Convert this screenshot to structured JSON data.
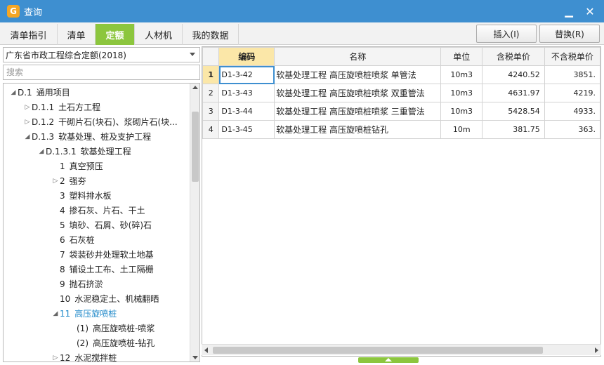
{
  "window": {
    "title": "查询",
    "app_icon": "app-logo-icon",
    "accent": "#3e8fd0"
  },
  "tabs": [
    {
      "label": "清单指引",
      "active": false
    },
    {
      "label": "清单",
      "active": false
    },
    {
      "label": "定额",
      "active": true
    },
    {
      "label": "人材机",
      "active": false
    },
    {
      "label": "我的数据",
      "active": false
    }
  ],
  "actions": {
    "insert_label": "插入(I)",
    "replace_label": "替换(R)"
  },
  "left": {
    "library_selected": "广东省市政工程综合定额(2018)",
    "search_placeholder": "搜索",
    "tree": [
      {
        "arrow": "◢",
        "code": "D.1",
        "label": "通用项目"
      },
      {
        "arrow": "▷",
        "code": "D.1.1",
        "label": "土石方工程"
      },
      {
        "arrow": "▷",
        "code": "D.1.2",
        "label": "干砌片石(块石)、浆砌片石(块..."
      },
      {
        "arrow": "◢",
        "code": "D.1.3",
        "label": "软基处理、桩及支护工程"
      },
      {
        "arrow": "◢",
        "code": "D.1.3.1",
        "label": "软基处理工程"
      },
      {
        "arrow": "",
        "code": "1",
        "label": "真空预压"
      },
      {
        "arrow": "▷",
        "code": "2",
        "label": "强夯"
      },
      {
        "arrow": "",
        "code": "3",
        "label": "塑料排水板"
      },
      {
        "arrow": "",
        "code": "4",
        "label": "掺石灰、片石、干土"
      },
      {
        "arrow": "",
        "code": "5",
        "label": "填砂、石屑、砂(碎)石"
      },
      {
        "arrow": "",
        "code": "6",
        "label": "石灰桩"
      },
      {
        "arrow": "",
        "code": "7",
        "label": "袋装砂井处理软土地基"
      },
      {
        "arrow": "",
        "code": "8",
        "label": "铺设土工布、土工隔栅"
      },
      {
        "arrow": "",
        "code": "9",
        "label": "抛石挤淤"
      },
      {
        "arrow": "",
        "code": "10",
        "label": "水泥稳定土、机械翻晒"
      },
      {
        "arrow": "◢",
        "code": "11",
        "label": "高压旋喷桩"
      },
      {
        "arrow": "",
        "code": "(1)",
        "label": "高压旋喷桩-喷浆"
      },
      {
        "arrow": "",
        "code": "(2)",
        "label": "高压旋喷桩-钻孔"
      },
      {
        "arrow": "▷",
        "code": "12",
        "label": "水泥搅拌桩"
      }
    ]
  },
  "grid": {
    "columns": [
      "",
      "编码",
      "名称",
      "单位",
      "含税单价",
      "不含税单价"
    ],
    "rows": [
      {
        "no": "1",
        "code": "D1-3-42",
        "name": "软基处理工程 高压旋喷桩喷浆 单管法",
        "unit": "10m3",
        "price_tax": "4240.52",
        "price_notax": "3851."
      },
      {
        "no": "2",
        "code": "D1-3-43",
        "name": "软基处理工程 高压旋喷桩喷浆 双重管法",
        "unit": "10m3",
        "price_tax": "4631.97",
        "price_notax": "4219."
      },
      {
        "no": "3",
        "code": "D1-3-44",
        "name": "软基处理工程 高压旋喷桩喷浆 三重管法",
        "unit": "10m3",
        "price_tax": "5428.54",
        "price_notax": "4933."
      },
      {
        "no": "4",
        "code": "D1-3-45",
        "name": "软基处理工程 高压旋喷桩钻孔",
        "unit": "10m",
        "price_tax": "381.75",
        "price_notax": "363."
      }
    ]
  }
}
